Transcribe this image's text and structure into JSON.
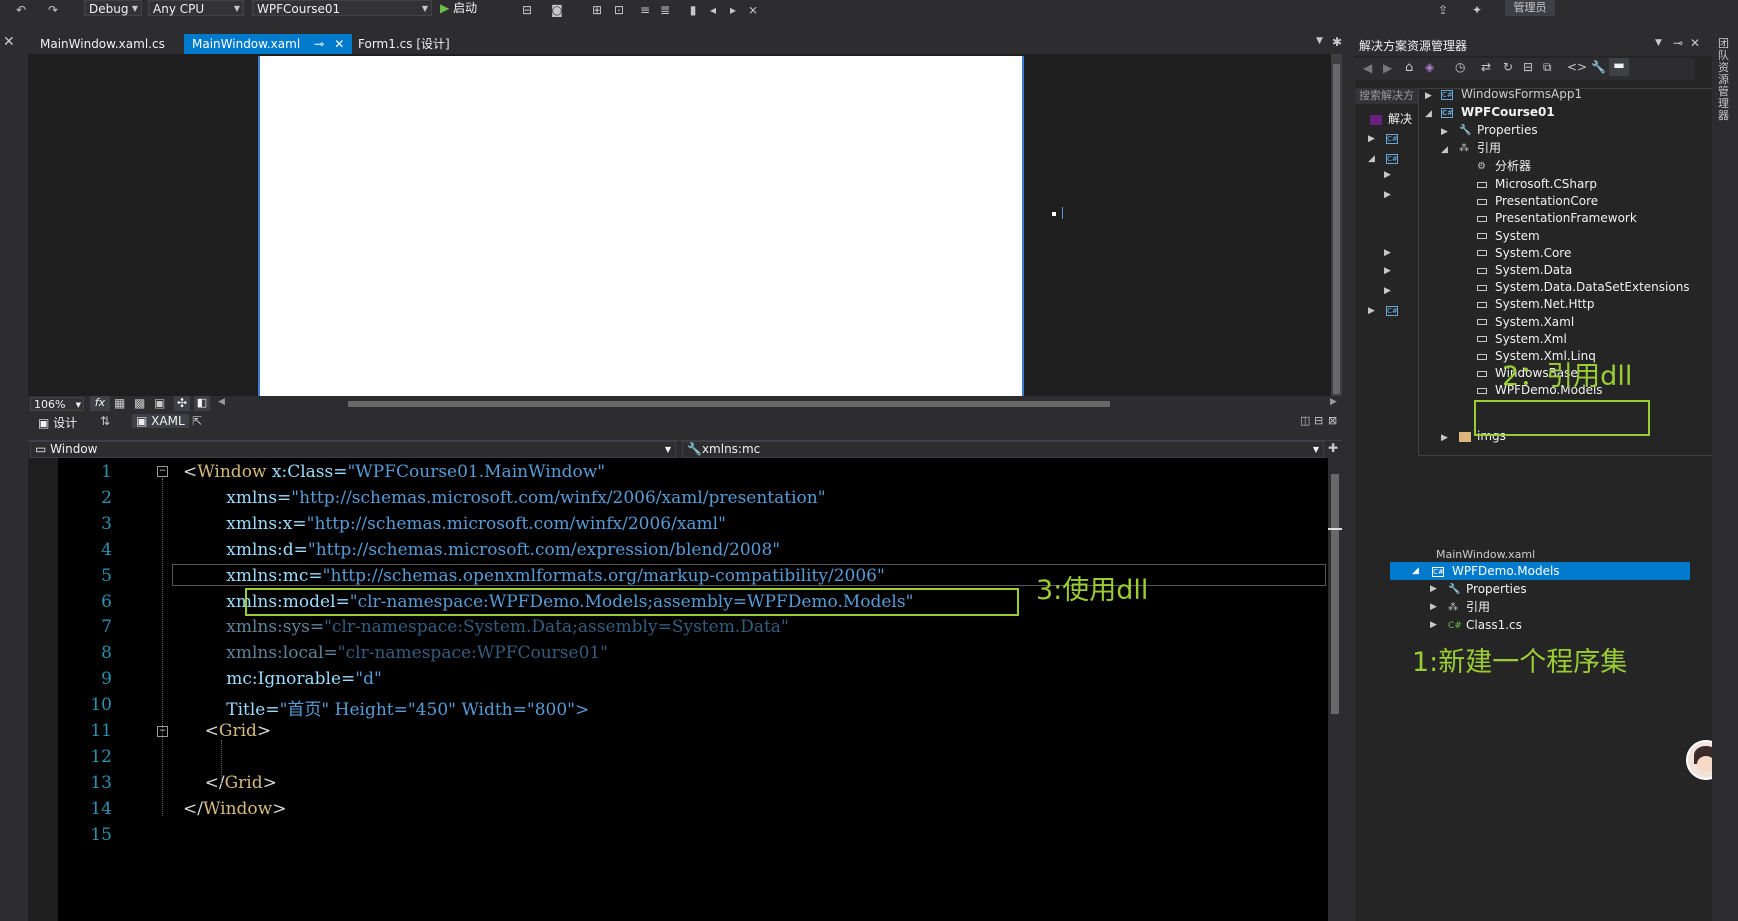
{
  "toolbar": {
    "config": "Debug",
    "platform": "Any CPU",
    "startup_project": "WPFCourse01",
    "start_label": "启动",
    "admin_label": "管理员"
  },
  "tabs": [
    {
      "label": "MainWindow.xaml.cs"
    },
    {
      "label": "MainWindow.xaml"
    },
    {
      "label": "Form1.cs [设计]"
    }
  ],
  "designer": {
    "zoom": "106%",
    "design_tab": "设计",
    "xaml_tab": "XAML",
    "nav_left": "Window",
    "nav_right": "xmlns:mc"
  },
  "code": {
    "line_numbers": [
      "1",
      "2",
      "3",
      "4",
      "5",
      "6",
      "7",
      "8",
      "9",
      "10",
      "11",
      "12",
      "13",
      "14",
      "15"
    ],
    "lines": [
      {
        "a": "<",
        "b": "Window",
        "c": " x:Class=",
        "d": "\"WPFCourse01.MainWindow\""
      },
      {
        "a": "        ",
        "b": "",
        "c": "xmlns=",
        "d": "\"http://schemas.microsoft.com/winfx/2006/xaml/presentation\""
      },
      {
        "a": "        ",
        "b": "",
        "c": "xmlns:x=",
        "d": "\"http://schemas.microsoft.com/winfx/2006/xaml\""
      },
      {
        "a": "        ",
        "b": "",
        "c": "xmlns:d=",
        "d": "\"http://schemas.microsoft.com/expression/blend/2008\""
      },
      {
        "a": "        ",
        "b": "",
        "c": "xmlns:mc=",
        "d": "\"http://schemas.openxmlformats.org/markup-compatibility/2006\""
      },
      {
        "a": "        ",
        "b": "",
        "c": "xmlns:model=",
        "d": "\"clr-namespace:WPFDemo.Models;assembly=WPFDemo.Models\""
      },
      {
        "a": "        ",
        "b": "",
        "c": "xmlns:sys=",
        "d": "\"clr-namespace:System.Data;assembly=System.Data\""
      },
      {
        "a": "        ",
        "b": "",
        "c": "xmlns:local=",
        "d": "\"clr-namespace:WPFCourse01\""
      },
      {
        "a": "        ",
        "b": "",
        "c": "mc:Ignorable=",
        "d": "\"d\""
      },
      {
        "a": "        ",
        "b": "",
        "c": "Title=",
        "d": "\"首页\" Height=\"450\" Width=\"800\">"
      },
      {
        "a": "    <",
        "b": "Grid",
        "c": ">",
        "d": ""
      },
      {
        "a": "",
        "b": "",
        "c": "",
        "d": ""
      },
      {
        "a": "    </",
        "b": "Grid",
        "c": ">",
        "d": ""
      },
      {
        "a": "</",
        "b": "Window",
        "c": ">",
        "d": ""
      },
      {
        "a": "",
        "b": "",
        "c": "",
        "d": ""
      }
    ]
  },
  "solution_explorer": {
    "title": "解决方案资源管理器",
    "search_placeholder": "搜索解决方",
    "side_label": "团队资源管理器",
    "tree": {
      "top_item": "WindowsFormsApp1",
      "project": "WPFCourse01",
      "properties": "Properties",
      "references": "引用",
      "analyzers": "分析器",
      "refs": [
        "Microsoft.CSharp",
        "PresentationCore",
        "PresentationFramework",
        "System",
        "System.Core",
        "System.Data",
        "System.Data.DataSetExtensions",
        "System.Net.Http",
        "System.Xaml",
        "System.Xml",
        "System.Xml.Linq",
        "WindowsBase",
        "WPFDemo.Models"
      ],
      "imgs": "imgs",
      "behind_label": "解决"
    },
    "models_project": {
      "cut_item": "MainWindow.xaml",
      "name": "WPFDemo.Models",
      "properties": "Properties",
      "references": "引用",
      "class_file": "Class1.cs"
    }
  },
  "annotations": {
    "a1": "1:新建一个程序集",
    "a2": "2：引用dll",
    "a3": "3:使用dll"
  }
}
